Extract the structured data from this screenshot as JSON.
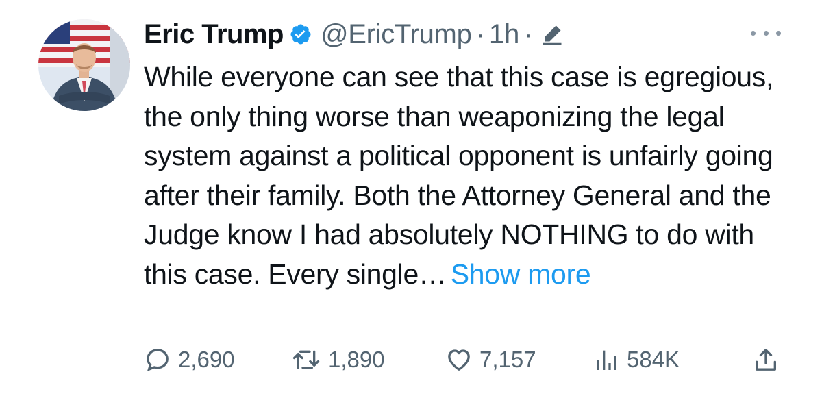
{
  "tweet": {
    "author_name": "Eric Trump",
    "handle": "@EricTrump",
    "separator": "·",
    "time": "1h",
    "text": "While everyone can see that this case is egregious, the only thing worse than weaponizing the legal system against a political opponent is unfairly going after their family. Both the Attorney General and the Judge know I had absolutely NOTHING to do with this case. Every single…",
    "show_more_label": "Show more",
    "verified": true,
    "edited": true
  },
  "actions": {
    "replies": "2,690",
    "retweets": "1,890",
    "likes": "7,157",
    "views": "584K"
  },
  "icons": {
    "verified": "verified-badge-icon",
    "edit": "edit-pencil-icon",
    "more": "more-options-icon",
    "reply": "reply-icon",
    "retweet": "retweet-icon",
    "like": "heart-icon",
    "views": "views-chart-icon",
    "share": "share-icon"
  },
  "colors": {
    "text": "#0f1419",
    "secondary": "#536471",
    "accent": "#1d9bf0"
  }
}
